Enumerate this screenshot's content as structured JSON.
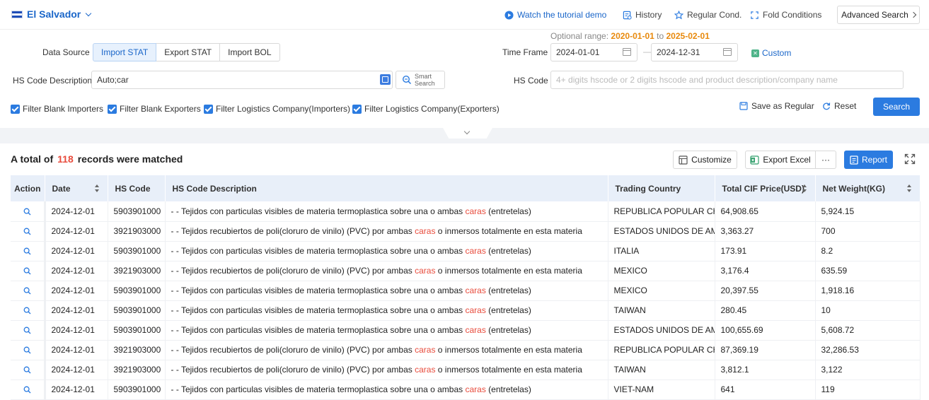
{
  "header": {
    "country": "El Salvador",
    "tutorial": "Watch the tutorial demo",
    "history": "History",
    "regular": "Regular Cond.",
    "fold": "Fold Conditions",
    "advanced": "Advanced Search"
  },
  "filters": {
    "optional_label": "Optional range:",
    "optional_from": "2020-01-01",
    "optional_to_word": "to",
    "optional_to": "2025-02-01",
    "data_source_label": "Data Source",
    "sources": [
      "Import STAT",
      "Export STAT",
      "Import BOL"
    ],
    "active_source": "Import STAT",
    "time_frame_label": "Time Frame",
    "date_from": "2024-01-01",
    "date_dash": "—",
    "date_to": "2024-12-31",
    "custom": "Custom",
    "hs_desc_label": "HS Code Description",
    "hs_desc_value": "Auto;car",
    "smart_search": [
      "Smart",
      "Search"
    ],
    "hs_code_label": "HS Code",
    "hs_code_placeholder": "4+ digits hscode or 2 digits hscode and product description/company name",
    "checkboxes": [
      "Filter Blank Importers",
      "Filter Blank Exporters",
      "Filter Logistics Company(Importers)",
      "Filter Logistics Company(Exporters)"
    ],
    "save_regular": "Save as Regular",
    "reset": "Reset",
    "search": "Search"
  },
  "results": {
    "prefix": "A total of",
    "count": "118",
    "suffix": "records were matched",
    "customize": "Customize",
    "export_excel": "Export Excel",
    "more": "···",
    "report": "Report"
  },
  "table": {
    "columns": [
      "Action",
      "Date",
      "HS Code",
      "HS Code Description",
      "Trading Country",
      "Total CIF Price(USD)",
      "Net Weight(KG)"
    ],
    "rows": [
      {
        "date": "2024-12-01",
        "hs": "5903901000",
        "d1": "- - Tejidos con particulas visibles de materia termoplastica sobre una o ambas ",
        "hl": "caras",
        "d2": " (entretelas)",
        "country": "REPUBLICA POPULAR CHI",
        "cif": "64,908.65",
        "weight": "5,924.15"
      },
      {
        "date": "2024-12-01",
        "hs": "3921903000",
        "d1": "- - Tejidos recubiertos de poli(cloruro de vinilo) (PVC) por ambas ",
        "hl": "caras",
        "d2": " o inmersos totalmente en esta materia",
        "country": "ESTADOS UNIDOS DE AME",
        "cif": "3,363.27",
        "weight": "700"
      },
      {
        "date": "2024-12-01",
        "hs": "5903901000",
        "d1": "- - Tejidos con particulas visibles de materia termoplastica sobre una o ambas ",
        "hl": "caras",
        "d2": " (entretelas)",
        "country": "ITALIA",
        "cif": "173.91",
        "weight": "8.2"
      },
      {
        "date": "2024-12-01",
        "hs": "3921903000",
        "d1": "- - Tejidos recubiertos de poli(cloruro de vinilo) (PVC) por ambas ",
        "hl": "caras",
        "d2": " o inmersos totalmente en esta materia",
        "country": "MEXICO",
        "cif": "3,176.4",
        "weight": "635.59"
      },
      {
        "date": "2024-12-01",
        "hs": "5903901000",
        "d1": "- - Tejidos con particulas visibles de materia termoplastica sobre una o ambas ",
        "hl": "caras",
        "d2": " (entretelas)",
        "country": "MEXICO",
        "cif": "20,397.55",
        "weight": "1,918.16"
      },
      {
        "date": "2024-12-01",
        "hs": "5903901000",
        "d1": "- - Tejidos con particulas visibles de materia termoplastica sobre una o ambas ",
        "hl": "caras",
        "d2": " (entretelas)",
        "country": "TAIWAN",
        "cif": "280.45",
        "weight": "10"
      },
      {
        "date": "2024-12-01",
        "hs": "5903901000",
        "d1": "- - Tejidos con particulas visibles de materia termoplastica sobre una o ambas ",
        "hl": "caras",
        "d2": " (entretelas)",
        "country": "ESTADOS UNIDOS DE AME",
        "cif": "100,655.69",
        "weight": "5,608.72"
      },
      {
        "date": "2024-12-01",
        "hs": "3921903000",
        "d1": "- - Tejidos recubiertos de poli(cloruro de vinilo) (PVC) por ambas ",
        "hl": "caras",
        "d2": " o inmersos totalmente en esta materia",
        "country": "REPUBLICA POPULAR CHI",
        "cif": "87,369.19",
        "weight": "32,286.53"
      },
      {
        "date": "2024-12-01",
        "hs": "3921903000",
        "d1": "- - Tejidos recubiertos de poli(cloruro de vinilo) (PVC) por ambas ",
        "hl": "caras",
        "d2": " o inmersos totalmente en esta materia",
        "country": "TAIWAN",
        "cif": "3,812.1",
        "weight": "3,122"
      },
      {
        "date": "2024-12-01",
        "hs": "5903901000",
        "d1": "- - Tejidos con particulas visibles de materia termoplastica sobre una o ambas ",
        "hl": "caras",
        "d2": " (entretelas)",
        "country": "VIET-NAM",
        "cif": "641",
        "weight": "119"
      }
    ]
  },
  "colors": {
    "accent": "#2b7be0",
    "link": "#1a66c9",
    "highlight": "#e84c3d",
    "date_range": "#e8890c",
    "header_bg": "#e8eff9"
  },
  "icons": {
    "tutorial": "play-circle-icon",
    "history": "history-icon",
    "regular": "star-icon",
    "fold": "fold-icon",
    "row_action": "magnifier-icon"
  }
}
